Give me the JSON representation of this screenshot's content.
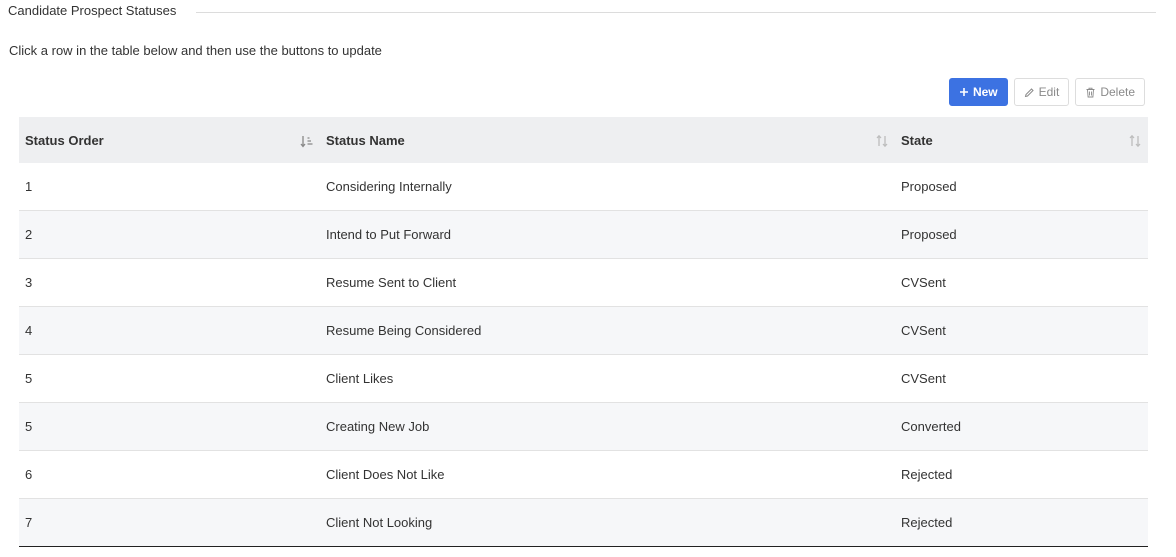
{
  "section": {
    "title": "Candidate Prospect Statuses",
    "instructions": "Click a row in the table below and then use the buttons to update"
  },
  "toolbar": {
    "new_label": "New",
    "edit_label": "Edit",
    "delete_label": "Delete"
  },
  "colors": {
    "accent": "#3c72e2",
    "header_bg": "#eeeff1",
    "row_alt_bg": "#f6f7f9"
  },
  "table": {
    "columns": [
      "Status Order",
      "Status Name",
      "State"
    ],
    "rows": [
      [
        "1",
        "Considering Internally",
        "Proposed"
      ],
      [
        "2",
        "Intend to Put Forward",
        "Proposed"
      ],
      [
        "3",
        "Resume Sent to Client",
        "CVSent"
      ],
      [
        "4",
        "Resume Being Considered",
        "CVSent"
      ],
      [
        "5",
        "Client Likes",
        "CVSent"
      ],
      [
        "5",
        "Creating New Job",
        "Converted"
      ],
      [
        "6",
        "Client Does Not Like",
        "Rejected"
      ],
      [
        "7",
        "Client Not Looking",
        "Rejected"
      ]
    ]
  }
}
